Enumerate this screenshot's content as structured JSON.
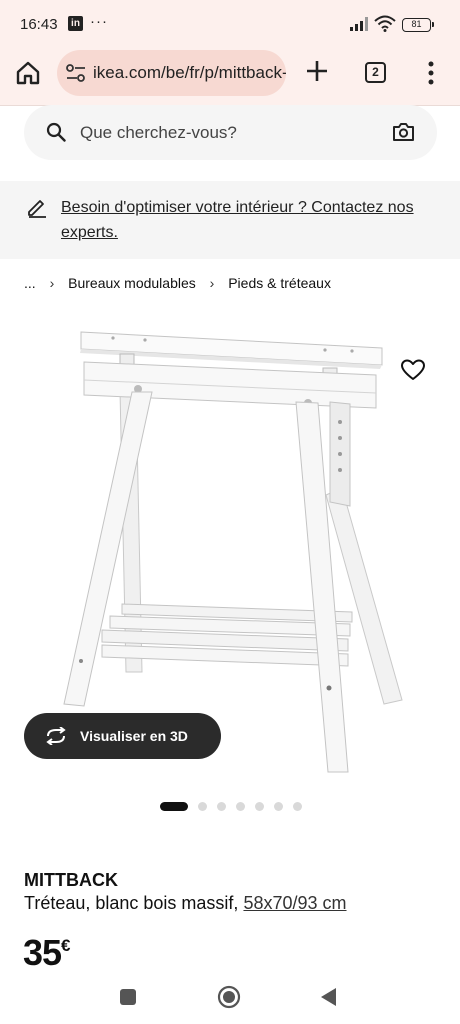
{
  "status_bar": {
    "time": "16:43",
    "linkedin": "in",
    "more": "···",
    "battery": "81"
  },
  "browser": {
    "url": "ikea.com/be/fr/p/mittback-treteau",
    "tab_count": "2"
  },
  "search": {
    "placeholder": "Que cherchez-vous?"
  },
  "banner": {
    "text": "Besoin d'optimiser votre intérieur ? Contactez nos experts."
  },
  "breadcrumb": {
    "ellipsis": "...",
    "items": [
      "Bureaux modulables",
      "Pieds & tréteaux"
    ]
  },
  "gallery": {
    "button_3d": "Visualiser en 3D",
    "slide_count": 7,
    "active_slide": 1
  },
  "product": {
    "name": "MITTBACK",
    "description": "Tréteau, blanc bois massif,",
    "size": "58x70/93 cm",
    "price": "35",
    "currency": "€"
  },
  "colors": {
    "browser_bg": "#fdf0ed",
    "url_pill": "#f7d9d2",
    "dark_button": "#2b2b2b",
    "panel_bg": "#f5f5f5"
  }
}
